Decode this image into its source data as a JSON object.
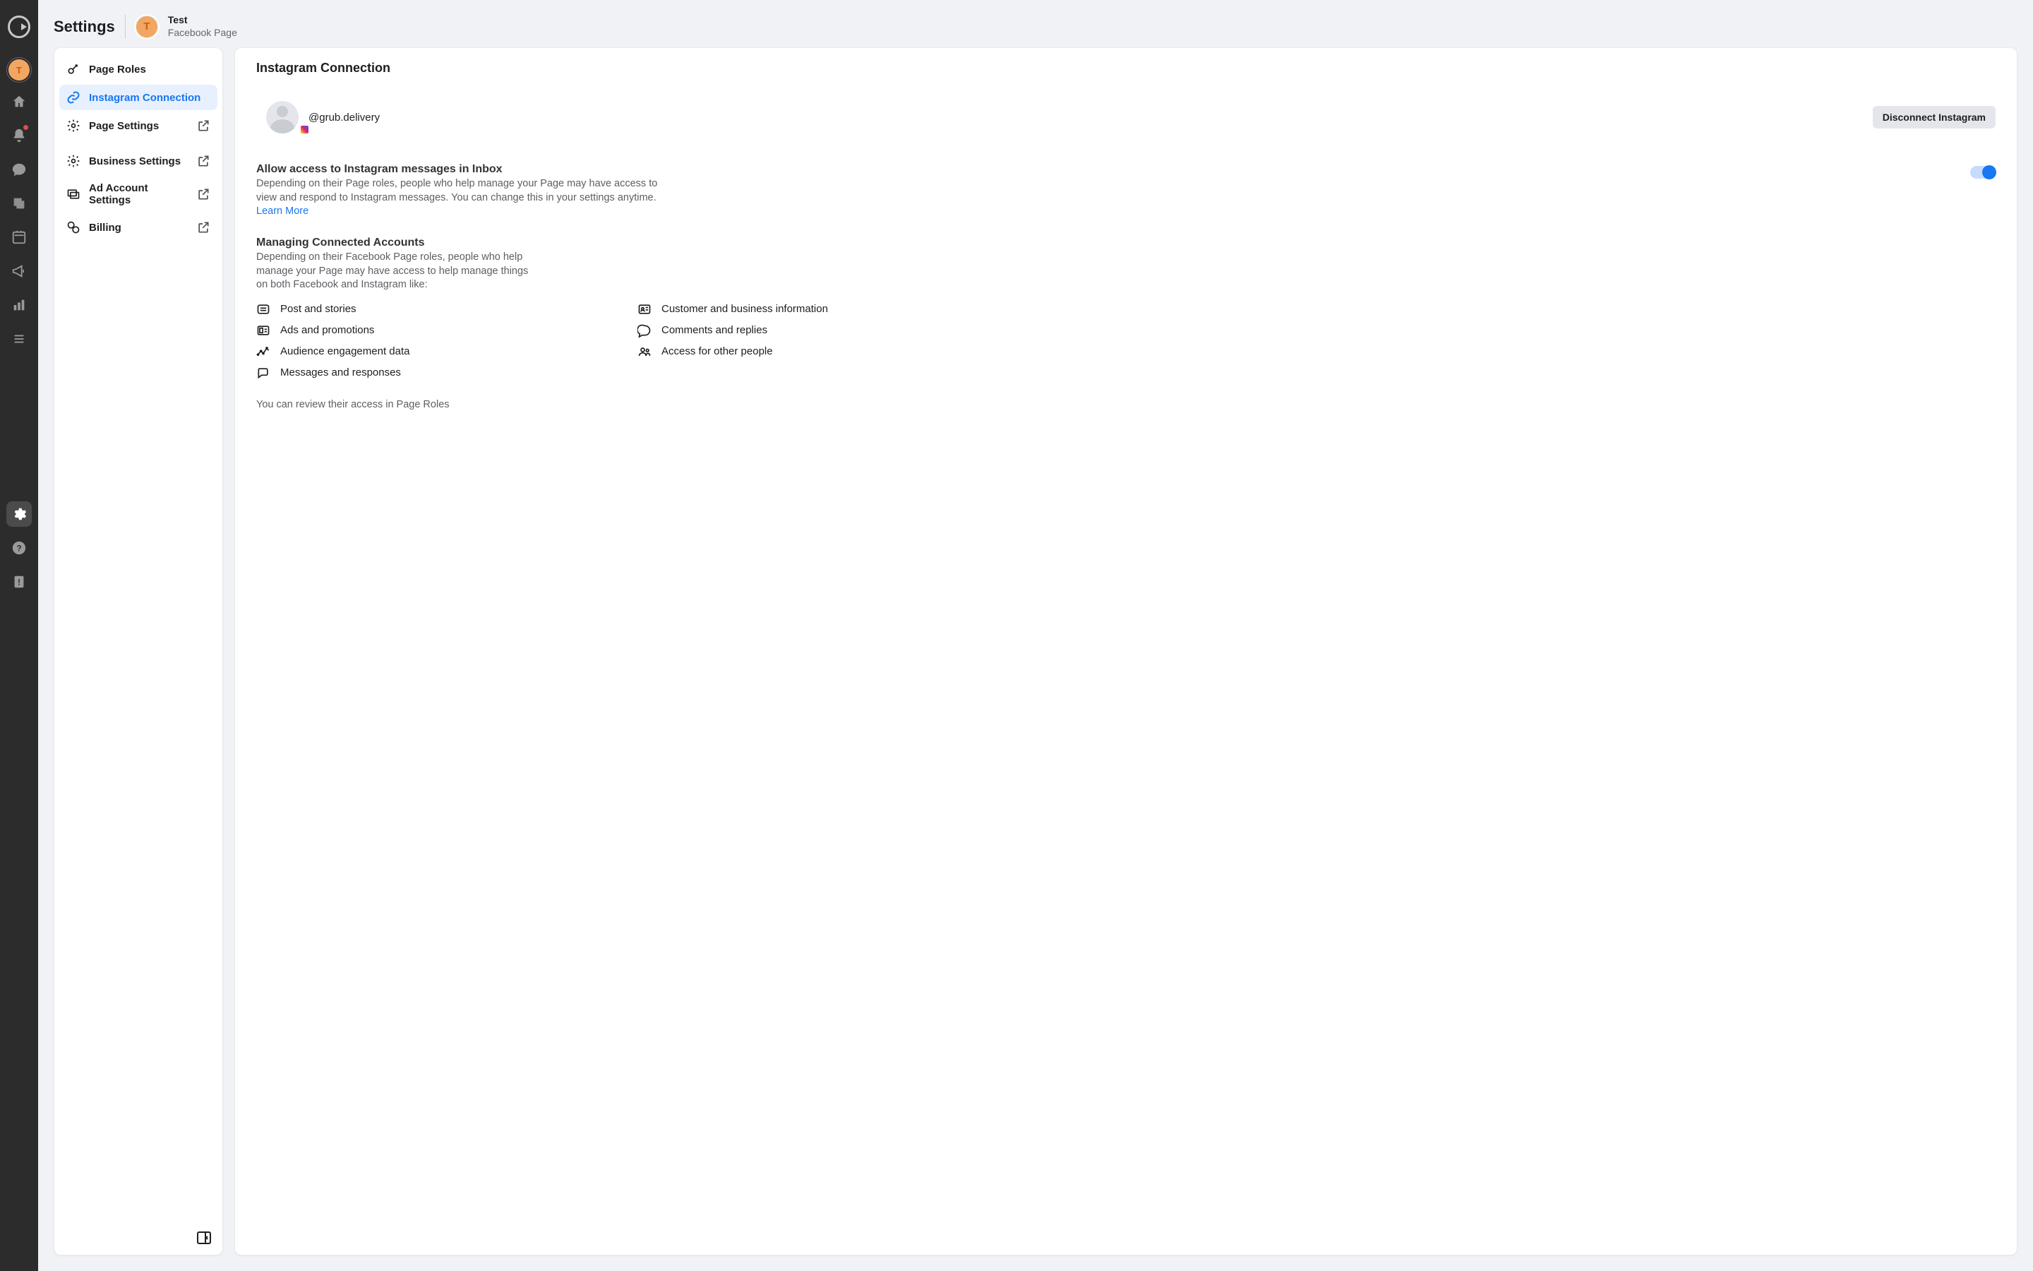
{
  "header": {
    "title": "Settings",
    "page_name": "Test",
    "page_type": "Facebook Page",
    "avatar_letter": "T"
  },
  "rail_avatar_letter": "T",
  "sidebar": {
    "items": [
      {
        "label": "Page Roles",
        "external": false,
        "active": false
      },
      {
        "label": "Instagram Connection",
        "external": false,
        "active": true
      },
      {
        "label": "Page Settings",
        "external": true,
        "active": false
      },
      {
        "label": "Business Settings",
        "external": true,
        "active": false
      },
      {
        "label": "Ad Account Settings",
        "external": true,
        "active": false
      },
      {
        "label": "Billing",
        "external": true,
        "active": false
      }
    ]
  },
  "content": {
    "heading": "Instagram Connection",
    "ig_handle": "@grub.delivery",
    "disconnect_label": "Disconnect Instagram",
    "allow_access": {
      "title": "Allow access to Instagram messages in Inbox",
      "desc": "Depending on their Page roles, people who help manage your Page may have access to view and respond to Instagram messages. You can change this in your settings anytime.",
      "learn_more": "Learn More",
      "toggle_on": true
    },
    "managing": {
      "title": "Managing Connected Accounts",
      "desc": "Depending on their Facebook Page roles, people who help manage your Page may have access to help manage things on both Facebook and Instagram like:",
      "features_left": [
        "Post and stories",
        "Ads and promotions",
        "Audience engagement data",
        "Messages and responses"
      ],
      "features_right": [
        "Customer and business information",
        "Comments and replies",
        "Access for other people"
      ],
      "footer": "You can review their access in Page Roles"
    }
  }
}
